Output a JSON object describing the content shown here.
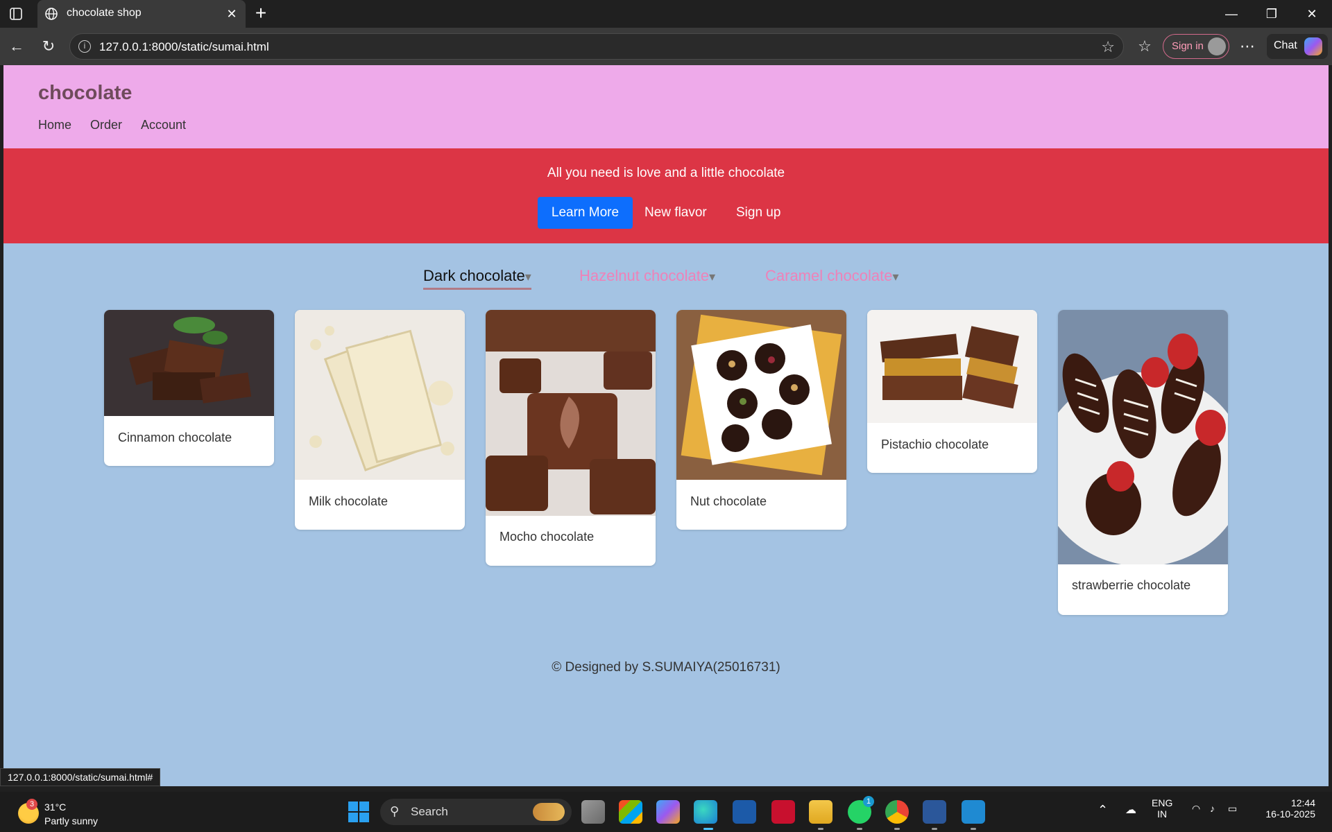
{
  "browser": {
    "tab_title": "chocolate shop",
    "url": "127.0.0.1:8000/static/sumai.html",
    "signin_label": "Sign in",
    "chat_label": "Chat",
    "status_url": "127.0.0.1:8000/static/sumai.html#"
  },
  "site": {
    "brand": "chocolate",
    "nav": [
      "Home",
      "Order",
      "Account"
    ]
  },
  "hero": {
    "tagline": "All you need is love and a little chocolate",
    "primary_button": "Learn More",
    "links": [
      "New flavor",
      "Sign up"
    ]
  },
  "flavors": {
    "tabs": [
      {
        "label": "Dark chocolate",
        "active": true
      },
      {
        "label": "Hazelnut chocolate",
        "active": false
      },
      {
        "label": "Caramel chocolate",
        "active": false
      }
    ],
    "caret": "▾",
    "active_color": "#111111",
    "inactive_color": "#ee82b8"
  },
  "products": [
    {
      "name": "Cinnamon chocolate"
    },
    {
      "name": "Milk chocolate"
    },
    {
      "name": "Mocho chocolate"
    },
    {
      "name": "Nut chocolate"
    },
    {
      "name": "Pistachio chocolate"
    },
    {
      "name": "strawberrie chocolate"
    }
  ],
  "footer": {
    "text": "© Designed by S.SUMAIYA(25016731)"
  },
  "colors": {
    "header_bg": "#eeaaea",
    "hero_bg": "#dc3545",
    "page_bg": "#a4c3e3",
    "primary_button": "#0d6efd"
  },
  "taskbar": {
    "weather_temp": "31°C",
    "weather_condition": "Partly sunny",
    "weather_badge": "3",
    "search_label": "Search",
    "whatsapp_badge": "1",
    "lang_top": "ENG",
    "lang_bottom": "IN",
    "time": "12:44",
    "date": "16-10-2025"
  }
}
